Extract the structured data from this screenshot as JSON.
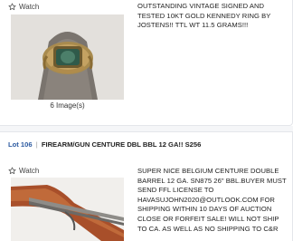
{
  "lot1": {
    "watch_label": "Watch",
    "image_count": "6 Image(s)",
    "description": "OUTSTANDING VINTAGE SIGNED AND TESTED 10KT GOLD KENNEDY RING BY JOSTENS!! TTL WT 11.5 GRAMS!!!"
  },
  "lot2": {
    "lot_number": "Lot 106",
    "title": "FIREARM/GUN CENTURE DBL BBL 12 GA!! S256",
    "watch_label": "Watch",
    "description": "SUPER NICE BELGIUM CENTURE DOUBLE BARREL 12 GA. SN875 26\" BBL.BUYER MUST SEND FFL LICENSE TO HAVASUJOHN2020@OUTLOOK.COM FOR SHIPPING WITHIN 10 DAYS OF AUCTION CLOSE OR FORFEIT SALE! WILL NOT SHIP TO CA. AS WELL AS NO SHIPPING TO C&R"
  },
  "colors": {
    "lot_link": "#2c5aa0",
    "border": "#e4e6ea",
    "text": "#222222"
  }
}
